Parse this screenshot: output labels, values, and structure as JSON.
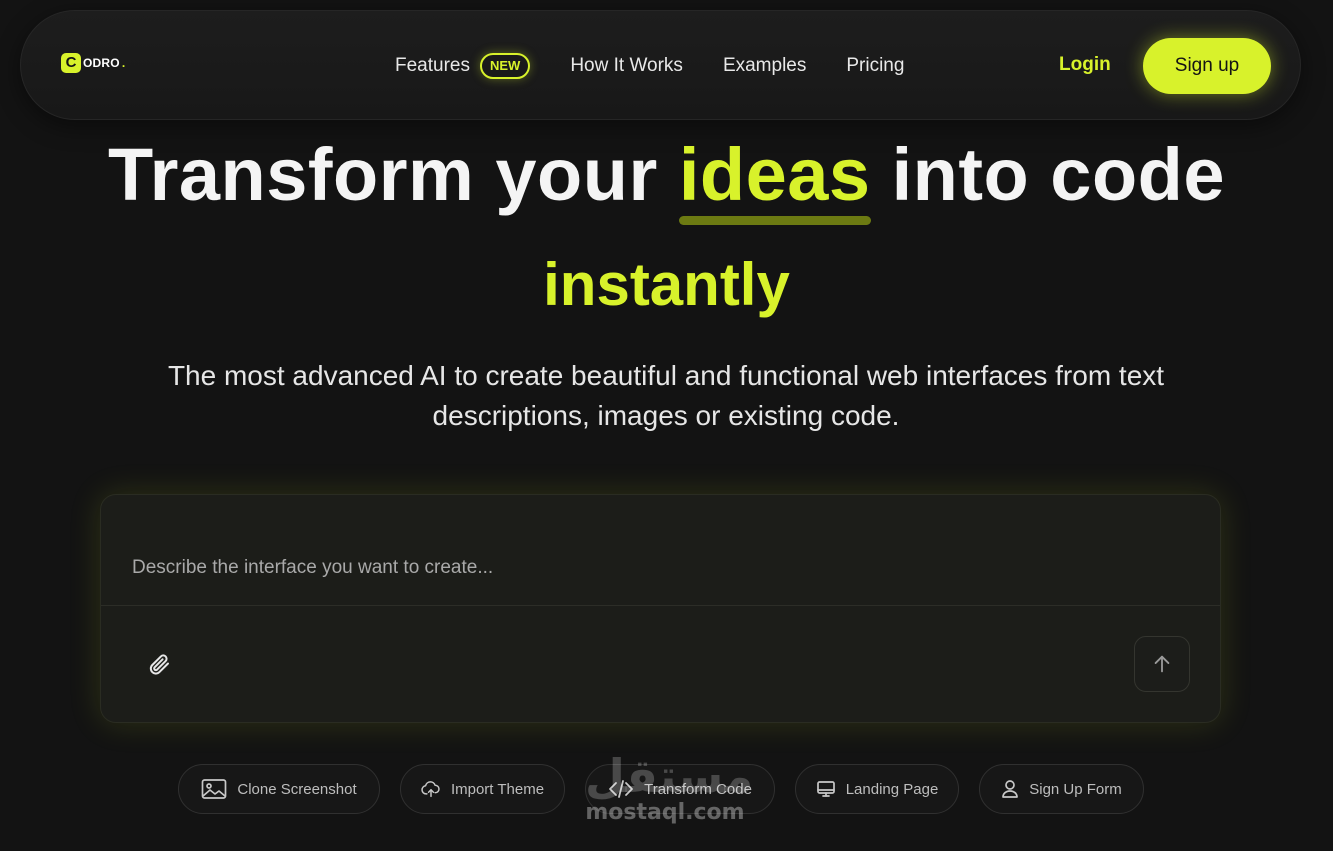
{
  "brand": {
    "logo_mark": "C",
    "logo_text": "ODRO",
    "logo_dot": ".",
    "accent_color": "#d8f22b"
  },
  "nav": {
    "links": [
      {
        "label": "Features",
        "badge": "NEW"
      },
      {
        "label": "How It Works"
      },
      {
        "label": "Examples"
      },
      {
        "label": "Pricing"
      }
    ],
    "login_label": "Login",
    "signup_label": "Sign up"
  },
  "hero": {
    "title_before": "Transform your ",
    "title_highlight": "ideas",
    "title_after": " into code",
    "title_line2": "instantly",
    "subtitle": "The most advanced AI to create beautiful and functional web interfaces from text descriptions, images or existing code."
  },
  "prompt": {
    "placeholder": "Describe the interface you want to create...",
    "value": "",
    "attach_icon": "paperclip-icon",
    "send_icon": "arrow-up-icon"
  },
  "chips": [
    {
      "label": "Clone Screenshot",
      "icon": "image-icon"
    },
    {
      "label": "Import Theme",
      "icon": "cloud-upload-icon"
    },
    {
      "label": "Transform Code",
      "icon": "code-icon"
    },
    {
      "label": "Landing Page",
      "icon": "monitor-icon"
    },
    {
      "label": "Sign Up Form",
      "icon": "user-icon"
    }
  ],
  "watermark": {
    "glyph": "مستقل",
    "text": "mostaql.com"
  }
}
